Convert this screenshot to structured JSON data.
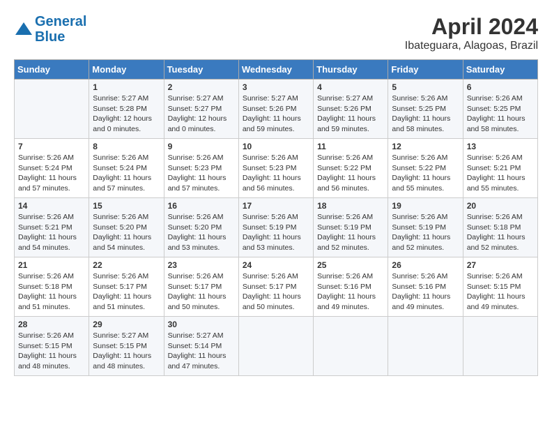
{
  "header": {
    "logo_line1": "General",
    "logo_line2": "Blue",
    "month_title": "April 2024",
    "location": "Ibateguara, Alagoas, Brazil"
  },
  "days_of_week": [
    "Sunday",
    "Monday",
    "Tuesday",
    "Wednesday",
    "Thursday",
    "Friday",
    "Saturday"
  ],
  "weeks": [
    [
      {
        "day": "",
        "info": ""
      },
      {
        "day": "1",
        "info": "Sunrise: 5:27 AM\nSunset: 5:28 PM\nDaylight: 12 hours\nand 0 minutes."
      },
      {
        "day": "2",
        "info": "Sunrise: 5:27 AM\nSunset: 5:27 PM\nDaylight: 12 hours\nand 0 minutes."
      },
      {
        "day": "3",
        "info": "Sunrise: 5:27 AM\nSunset: 5:26 PM\nDaylight: 11 hours\nand 59 minutes."
      },
      {
        "day": "4",
        "info": "Sunrise: 5:27 AM\nSunset: 5:26 PM\nDaylight: 11 hours\nand 59 minutes."
      },
      {
        "day": "5",
        "info": "Sunrise: 5:26 AM\nSunset: 5:25 PM\nDaylight: 11 hours\nand 58 minutes."
      },
      {
        "day": "6",
        "info": "Sunrise: 5:26 AM\nSunset: 5:25 PM\nDaylight: 11 hours\nand 58 minutes."
      }
    ],
    [
      {
        "day": "7",
        "info": "Sunrise: 5:26 AM\nSunset: 5:24 PM\nDaylight: 11 hours\nand 57 minutes."
      },
      {
        "day": "8",
        "info": "Sunrise: 5:26 AM\nSunset: 5:24 PM\nDaylight: 11 hours\nand 57 minutes."
      },
      {
        "day": "9",
        "info": "Sunrise: 5:26 AM\nSunset: 5:23 PM\nDaylight: 11 hours\nand 57 minutes."
      },
      {
        "day": "10",
        "info": "Sunrise: 5:26 AM\nSunset: 5:23 PM\nDaylight: 11 hours\nand 56 minutes."
      },
      {
        "day": "11",
        "info": "Sunrise: 5:26 AM\nSunset: 5:22 PM\nDaylight: 11 hours\nand 56 minutes."
      },
      {
        "day": "12",
        "info": "Sunrise: 5:26 AM\nSunset: 5:22 PM\nDaylight: 11 hours\nand 55 minutes."
      },
      {
        "day": "13",
        "info": "Sunrise: 5:26 AM\nSunset: 5:21 PM\nDaylight: 11 hours\nand 55 minutes."
      }
    ],
    [
      {
        "day": "14",
        "info": "Sunrise: 5:26 AM\nSunset: 5:21 PM\nDaylight: 11 hours\nand 54 minutes."
      },
      {
        "day": "15",
        "info": "Sunrise: 5:26 AM\nSunset: 5:20 PM\nDaylight: 11 hours\nand 54 minutes."
      },
      {
        "day": "16",
        "info": "Sunrise: 5:26 AM\nSunset: 5:20 PM\nDaylight: 11 hours\nand 53 minutes."
      },
      {
        "day": "17",
        "info": "Sunrise: 5:26 AM\nSunset: 5:19 PM\nDaylight: 11 hours\nand 53 minutes."
      },
      {
        "day": "18",
        "info": "Sunrise: 5:26 AM\nSunset: 5:19 PM\nDaylight: 11 hours\nand 52 minutes."
      },
      {
        "day": "19",
        "info": "Sunrise: 5:26 AM\nSunset: 5:19 PM\nDaylight: 11 hours\nand 52 minutes."
      },
      {
        "day": "20",
        "info": "Sunrise: 5:26 AM\nSunset: 5:18 PM\nDaylight: 11 hours\nand 52 minutes."
      }
    ],
    [
      {
        "day": "21",
        "info": "Sunrise: 5:26 AM\nSunset: 5:18 PM\nDaylight: 11 hours\nand 51 minutes."
      },
      {
        "day": "22",
        "info": "Sunrise: 5:26 AM\nSunset: 5:17 PM\nDaylight: 11 hours\nand 51 minutes."
      },
      {
        "day": "23",
        "info": "Sunrise: 5:26 AM\nSunset: 5:17 PM\nDaylight: 11 hours\nand 50 minutes."
      },
      {
        "day": "24",
        "info": "Sunrise: 5:26 AM\nSunset: 5:17 PM\nDaylight: 11 hours\nand 50 minutes."
      },
      {
        "day": "25",
        "info": "Sunrise: 5:26 AM\nSunset: 5:16 PM\nDaylight: 11 hours\nand 49 minutes."
      },
      {
        "day": "26",
        "info": "Sunrise: 5:26 AM\nSunset: 5:16 PM\nDaylight: 11 hours\nand 49 minutes."
      },
      {
        "day": "27",
        "info": "Sunrise: 5:26 AM\nSunset: 5:15 PM\nDaylight: 11 hours\nand 49 minutes."
      }
    ],
    [
      {
        "day": "28",
        "info": "Sunrise: 5:26 AM\nSunset: 5:15 PM\nDaylight: 11 hours\nand 48 minutes."
      },
      {
        "day": "29",
        "info": "Sunrise: 5:27 AM\nSunset: 5:15 PM\nDaylight: 11 hours\nand 48 minutes."
      },
      {
        "day": "30",
        "info": "Sunrise: 5:27 AM\nSunset: 5:14 PM\nDaylight: 11 hours\nand 47 minutes."
      },
      {
        "day": "",
        "info": ""
      },
      {
        "day": "",
        "info": ""
      },
      {
        "day": "",
        "info": ""
      },
      {
        "day": "",
        "info": ""
      }
    ]
  ]
}
